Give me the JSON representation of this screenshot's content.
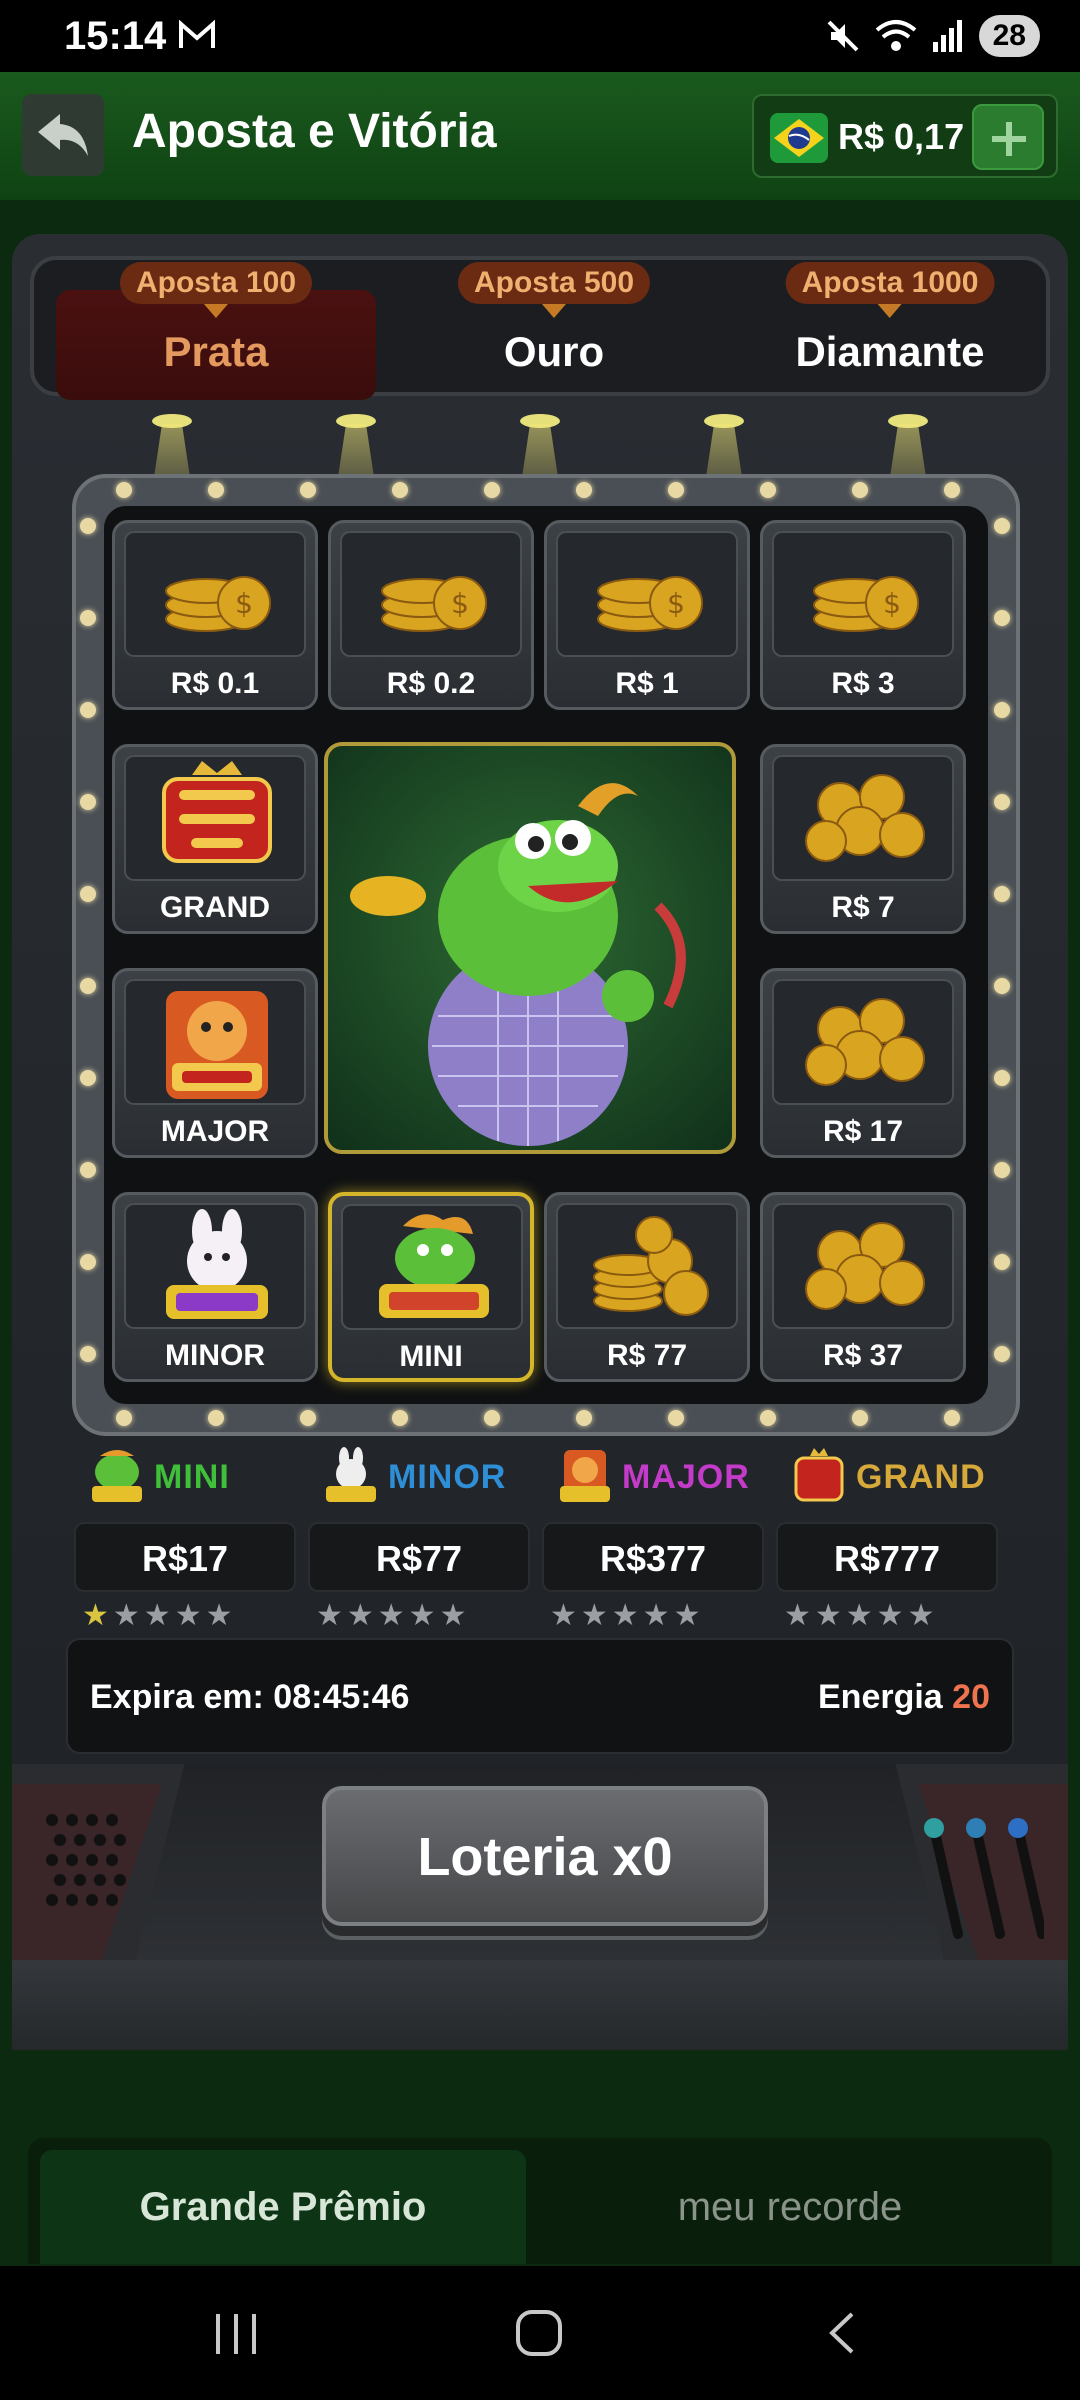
{
  "status": {
    "time": "15:14",
    "battery": "28"
  },
  "header": {
    "title": "Aposta e Vitória",
    "balance": "R$ 0,17"
  },
  "tiers": [
    {
      "badge": "Aposta 100",
      "label": "Prata"
    },
    {
      "badge": "Aposta 500",
      "label": "Ouro"
    },
    {
      "badge": "Aposta 1000",
      "label": "Diamante"
    }
  ],
  "tiles": {
    "t1": "R$ 0.1",
    "t2": "R$ 0.2",
    "t3": "R$ 1",
    "t4": "R$ 3",
    "t5": "GRAND",
    "t6": "R$ 7",
    "t7": "MAJOR",
    "t8": "R$ 17",
    "t9": "MINOR",
    "t10": "MINI",
    "t11": "R$ 77",
    "t12": "R$ 37"
  },
  "jackpots": [
    {
      "name": "MINI",
      "value": "R$17",
      "stars_on": 1,
      "color": "#3fbf3a"
    },
    {
      "name": "MINOR",
      "value": "R$77",
      "stars_on": 0,
      "color": "#2e8fd6"
    },
    {
      "name": "MAJOR",
      "value": "R$377",
      "stars_on": 0,
      "color": "#c43bc9"
    },
    {
      "name": "GRAND",
      "value": "R$777",
      "stars_on": 0,
      "color": "#d6a93a"
    }
  ],
  "stars_glyph": "★★★★★",
  "info": {
    "expira": "Expira em: 08:45:46",
    "energia_label": "Energia",
    "energia_value": "20"
  },
  "lottery_button": "Loteria x0",
  "bottom_tabs": {
    "active": "Grande Prêmio",
    "inactive": "meu recorde"
  },
  "colors": {
    "header_green": "#1a5a1e",
    "accent_orange": "#e49a5e",
    "energy": "#f07350",
    "highlight": "#d5b52a"
  },
  "icons": [
    "mail-icon",
    "mute-icon",
    "wifi-icon",
    "signal-icon",
    "back-arrow-icon",
    "brazil-flag-icon",
    "plus-icon",
    "coins-icon",
    "grand-win-icon",
    "wild-tiger-icon",
    "wild-rabbit-icon",
    "wild-dragon-icon",
    "dragon-disco-art"
  ]
}
